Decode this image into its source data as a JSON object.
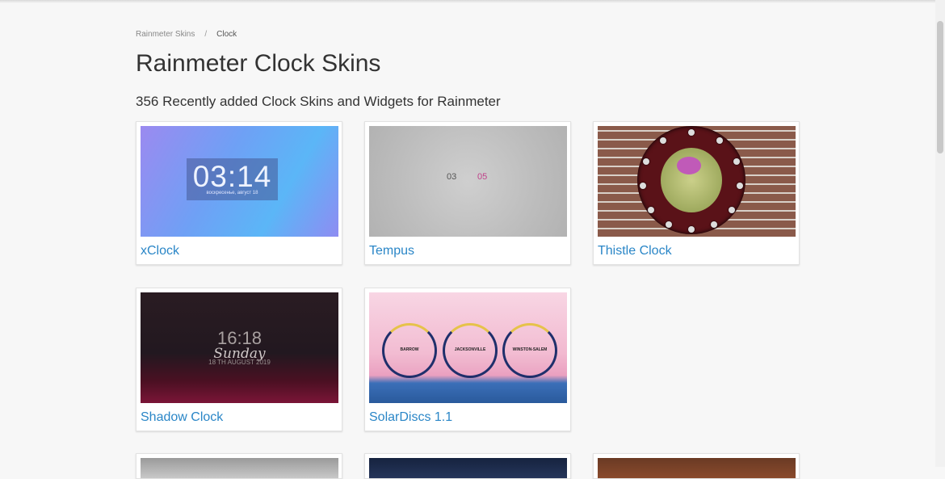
{
  "breadcrumb": {
    "home": "Rainmeter Skins",
    "separator": "/",
    "current": "Clock"
  },
  "page": {
    "title": "Rainmeter Clock Skins",
    "subtitle": "356 Recently added Clock Skins and Widgets for Rainmeter"
  },
  "skins": [
    {
      "title": "xClock",
      "thumb_time": "03:14",
      "thumb_date": "воскресенье, август 18"
    },
    {
      "title": "Tempus",
      "thumb_hour": "03",
      "thumb_minute": "05"
    },
    {
      "title": "Thistle Clock"
    },
    {
      "title": "Shadow Clock",
      "thumb_time": "16:18",
      "thumb_day": "Sunday",
      "thumb_date": "18 TH AUGUST 2019"
    },
    {
      "title": "SolarDiscs 1.1",
      "thumb_cities": [
        "BARROW",
        "JACKSONVILLE",
        "WINSTON-SALEM"
      ]
    }
  ],
  "colors": {
    "link": "#2a86c7",
    "background": "#f7f7f7"
  }
}
